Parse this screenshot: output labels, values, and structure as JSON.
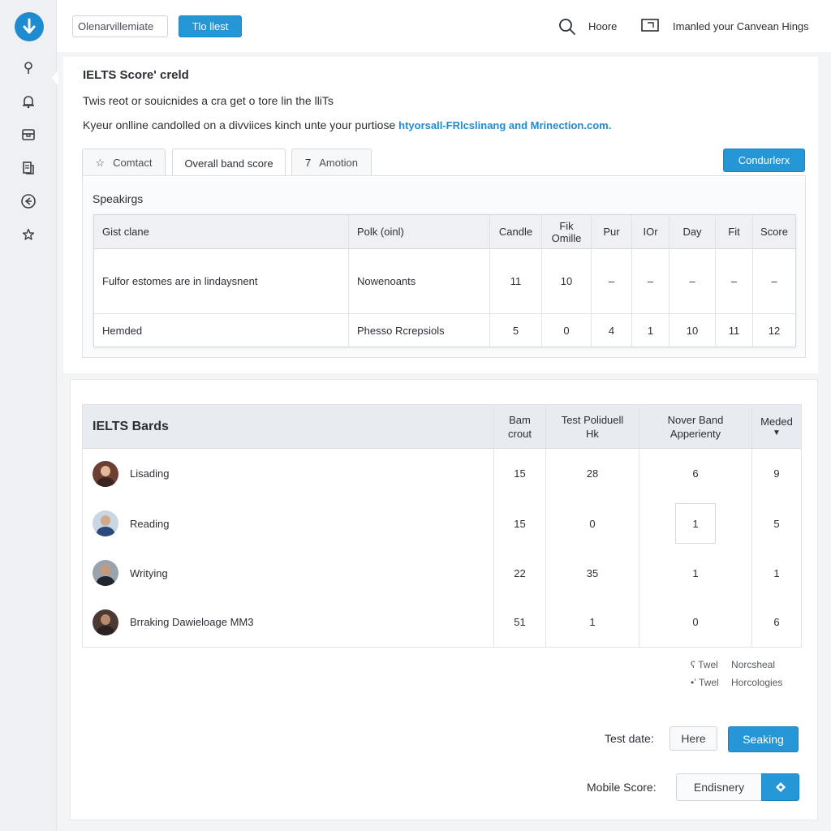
{
  "topbar": {
    "search_value": "Olenarvillemiate",
    "button_label": "Tlo llest",
    "home_label": "Hoore",
    "canvas_label": "Imanled your Canvean Hings"
  },
  "page": {
    "title": "IELTS Score' creld",
    "desc1": "Twis reot or souicnides a cra get o tore lin the lliTs",
    "desc2_prefix": "Kyeur onlline candolled on a divviices kinch unte your purtiose ",
    "desc2_link": "htyorsall-FRlcslinang and Mrinection.com."
  },
  "tabs": [
    {
      "label": "Comtact",
      "icon": "star-outline-icon"
    },
    {
      "label": "Overall band score"
    },
    {
      "label": "Amotion",
      "prefix": "7"
    }
  ],
  "conduct_button": "Condurlerx",
  "speaking": {
    "label": "Speakirgs",
    "headers": [
      "Gist clane",
      "Polk (oinl)",
      "Candle",
      "Fik Omille",
      "Pur",
      "IOr",
      "Day",
      "Fit",
      "Score"
    ],
    "rows": [
      [
        "Fulfor estomes are in lindaysnent",
        "Nowenoants",
        "11",
        "10",
        "–",
        "–",
        "–",
        "–",
        "–"
      ],
      [
        "Hemded",
        "Phesso Rcrepsiols",
        "5",
        "0",
        "4",
        "1",
        "10",
        "11",
        "12"
      ]
    ]
  },
  "bands": {
    "title": "IELTS Bards",
    "headers": [
      "Bam crout",
      "Test Poliduell Hk",
      "Nover Band Apperienty",
      "Meded"
    ],
    "rows": [
      {
        "name": "Lisading",
        "values": [
          "15",
          "28",
          "6",
          "9"
        ]
      },
      {
        "name": "Reading",
        "values": [
          "15",
          "0",
          "1",
          "5"
        ]
      },
      {
        "name": "Writying",
        "values": [
          "22",
          "35",
          "1",
          "1"
        ]
      },
      {
        "name": "Brraking Dawieloage MM3",
        "values": [
          "51",
          "1",
          "0",
          "6"
        ]
      }
    ]
  },
  "legend": [
    {
      "mark": "ʕ Twel",
      "label": "Norcsheal"
    },
    {
      "mark": "•ʼ Twel",
      "label": "Horcologies"
    }
  ],
  "footer": {
    "test_date_label": "Test date:",
    "here_button": "Here",
    "seaking_button": "Seaking",
    "mobile_label": "Mobile Score:",
    "mobile_value": "Endisnery"
  },
  "colors": {
    "accent": "#2596d6",
    "link": "#1f8bd0"
  }
}
